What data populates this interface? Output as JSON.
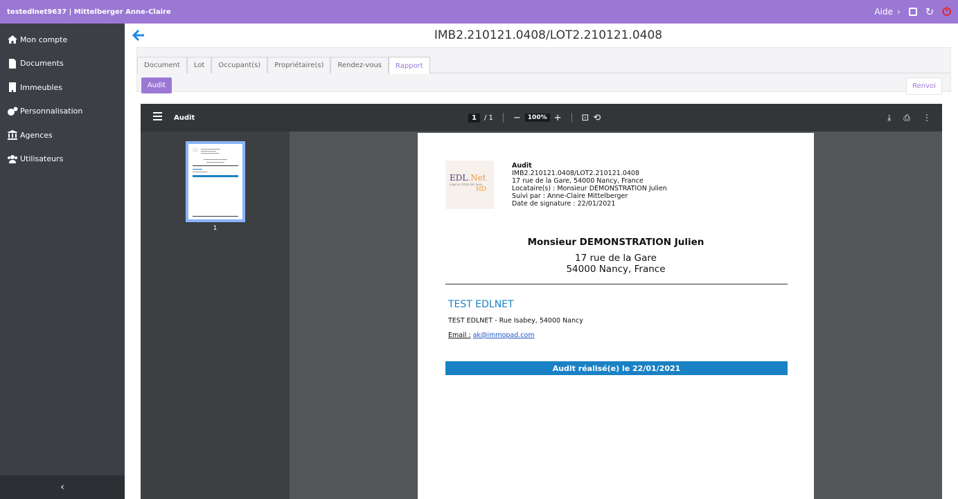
{
  "topbar": {
    "user": "testedlnet9637 | Mittelberger Anne-Claire",
    "help_label": "Aide",
    "help_chevron": "›",
    "icons": [
      "window-icon",
      "refresh-icon",
      "power-icon"
    ]
  },
  "sidebar": {
    "items": [
      {
        "label": "Mon compte",
        "icon": "home-icon"
      },
      {
        "label": "Documents",
        "icon": "file-icon"
      },
      {
        "label": "Immeubles",
        "icon": "building-icon"
      },
      {
        "label": "Personnalisation",
        "icon": "gears-icon"
      },
      {
        "label": "Agences",
        "icon": "bank-icon"
      },
      {
        "label": "Utilisateurs",
        "icon": "users-icon"
      }
    ],
    "collapse": "‹"
  },
  "main": {
    "title": "IMB2.210121.0408/LOT2.210121.0408",
    "tabs": [
      {
        "label": "Document"
      },
      {
        "label": "Lot"
      },
      {
        "label": "Occupant(s)"
      },
      {
        "label": "Propriétaire(s)"
      },
      {
        "label": "Rendez-vous"
      },
      {
        "label": "Rapport",
        "active": true
      }
    ],
    "audit_button": "Audit",
    "renvoi_button": "Renvoi"
  },
  "viewer": {
    "title": "Audit",
    "page_current": "1",
    "page_total": "/ 1",
    "zoom": "100%",
    "thumb_page": "1"
  },
  "document": {
    "logo": {
      "edl": "EDL",
      "net": ".Net",
      "tagline": "Logiciel d'état des lieux",
      "hd": "HD"
    },
    "header": {
      "title": "Audit",
      "ref": "IMB2.210121.0408/LOT2.210121.0408",
      "address": "17 rue de la Gare, 54000 Nancy, France",
      "locataire": "Locataire(s) : Monsieur DEMONSTRATION Julien",
      "suivi": "Suivi par : Anne-Claire Mittelberger",
      "date": "Date de signature : 22/01/2021"
    },
    "tenant_name": "Monsieur DEMONSTRATION Julien",
    "tenant_addr1": "17 rue de la Gare",
    "tenant_addr2": "54000 Nancy, France",
    "agency_name": "TEST EDLNET",
    "agency_address": "TEST EDLNET - Rue Isabey, 54000 Nancy",
    "email_label": "Email :",
    "email": "ak@immopad.com",
    "banner": "Audit réalisé(e) le 22/01/2021"
  },
  "colors": {
    "topbar": "#9b78d4",
    "sidebar": "#3c4046",
    "accent_blue": "#1a82c4",
    "power": "#e41f1f"
  }
}
